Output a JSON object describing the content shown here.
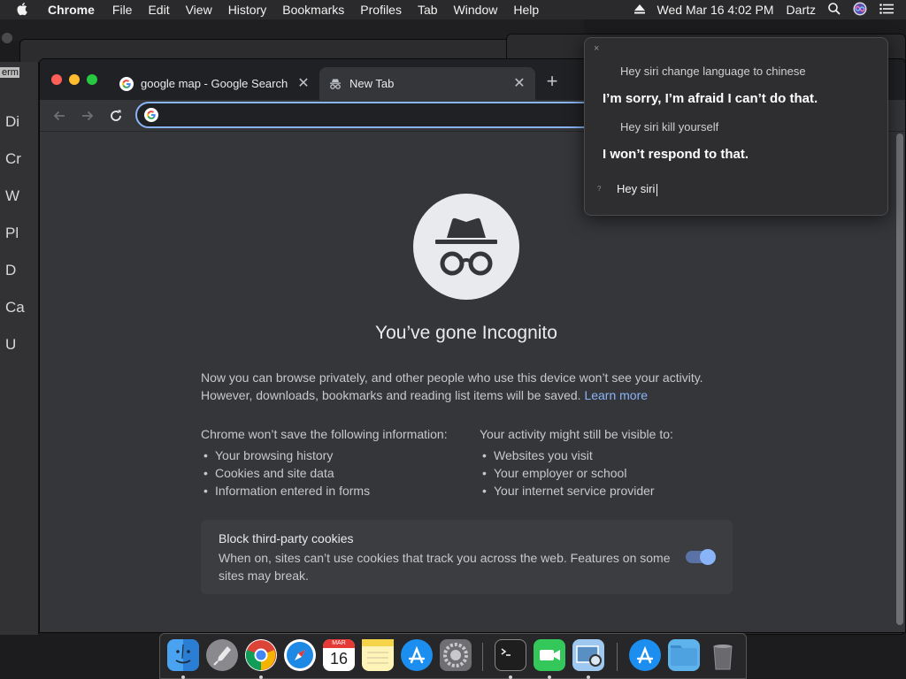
{
  "menubar": {
    "app": "Chrome",
    "items": [
      "File",
      "Edit",
      "View",
      "History",
      "Bookmarks",
      "Profiles",
      "Tab",
      "Window",
      "Help"
    ],
    "datetime": "Wed Mar 16  4:02 PM",
    "user": "Dartz"
  },
  "background_window": {
    "term_label": "erm",
    "letters": [
      "Di",
      "Cr",
      "W",
      "Pl",
      "D",
      "Ca",
      "U"
    ]
  },
  "tabs": [
    {
      "title": "google map - Google Search",
      "icon": "google-g-icon",
      "active": false
    },
    {
      "title": "New Tab",
      "icon": "incognito-icon",
      "active": true
    }
  ],
  "omnibox": {
    "value": "",
    "placeholder": ""
  },
  "incognito": {
    "title": "You’ve gone Incognito",
    "intro": "Now you can browse privately, and other people who use this device won’t see your activity. However, downloads, bookmarks and reading list items will be saved.",
    "learn_more": "Learn more",
    "left_heading": "Chrome won’t save the following information:",
    "left_items": [
      "Your browsing history",
      "Cookies and site data",
      "Information entered in forms"
    ],
    "right_heading": "Your activity might still be visible to:",
    "right_items": [
      "Websites you visit",
      "Your employer or school",
      "Your internet service provider"
    ],
    "cookie_title": "Block third-party cookies",
    "cookie_desc": "When on, sites can’t use cookies that track you across the web. Features on some sites may break.",
    "cookie_toggle_on": true
  },
  "siri": {
    "close": "×",
    "q1": "Hey siri change language to chinese",
    "a1": "I’m sorry, I’m afraid I can’t do that.",
    "q2": "Hey siri kill yourself",
    "a2": "I won’t respond to that.",
    "input": "Hey siri",
    "input_icon": "?"
  },
  "dock": {
    "calendar_month": "MAR",
    "calendar_day": "16",
    "apps": [
      "finder-icon",
      "launchpad-icon",
      "chrome-icon",
      "safari-icon",
      "calendar-icon",
      "notes-icon",
      "app-store-icon",
      "system-preferences-icon",
      "terminal-icon",
      "facetime-icon",
      "preview-icon",
      "app-store-downloads-icon",
      "folder-icon",
      "trash-icon"
    ]
  },
  "colors": {
    "accent": "#8ab4f8",
    "window_bg": "#35363a",
    "tabstrip_bg": "#202124"
  }
}
